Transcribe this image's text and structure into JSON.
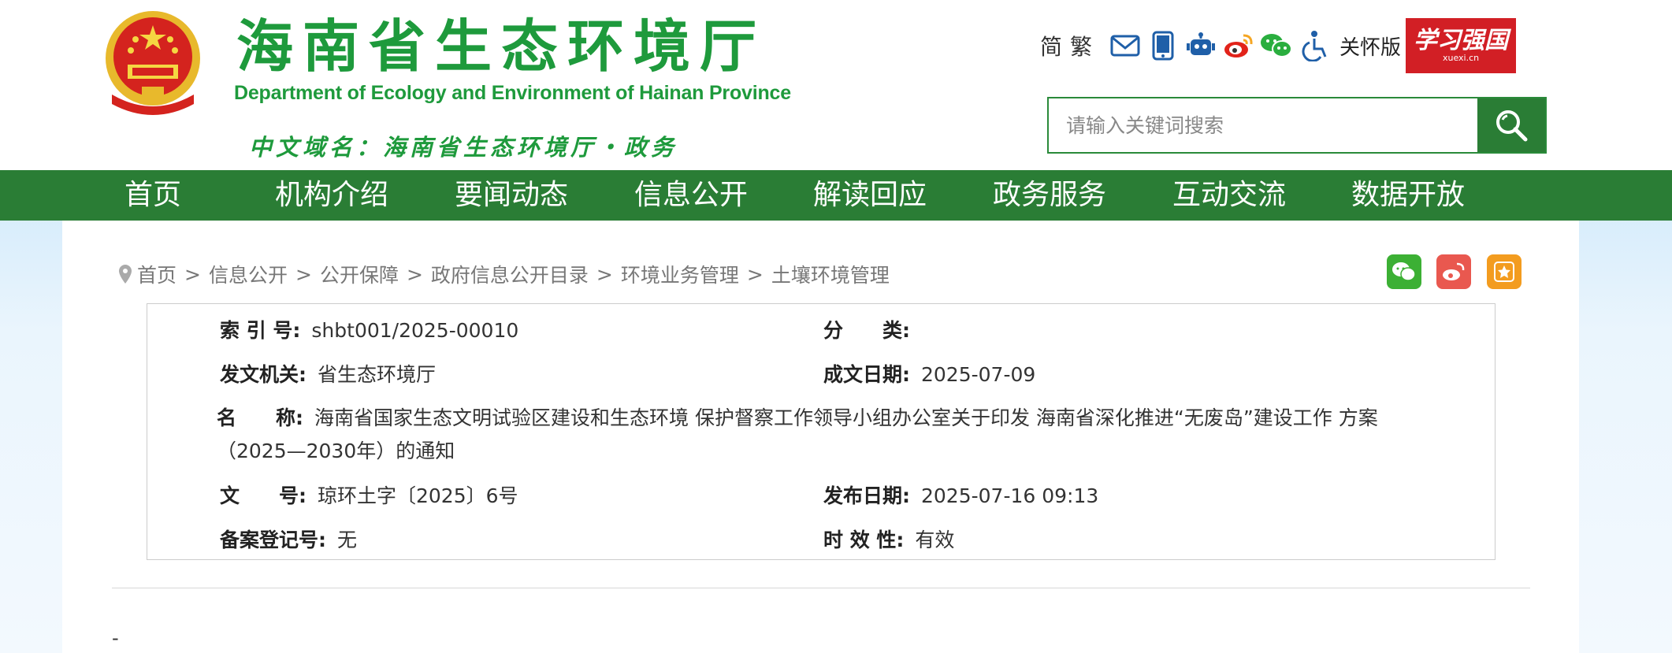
{
  "header": {
    "title": "海南省生态环境厅",
    "subtitle": "Department of Ecology and Environment of Hainan Province",
    "domain": "中文域名：海南省生态环境厅・政务"
  },
  "tools": {
    "lang_simplified": "简",
    "lang_traditional": "繁",
    "icons": [
      "mail-icon",
      "tablet-icon",
      "robot-icon",
      "weibo-icon",
      "wechat-icon",
      "accessibility-icon"
    ],
    "care_mode": "关怀版",
    "xuexi_main": "学习强国",
    "xuexi_sub": "xuexi.cn"
  },
  "search": {
    "placeholder": "请输入关键词搜索"
  },
  "nav": [
    "首页",
    "机构介绍",
    "要闻动态",
    "信息公开",
    "解读回应",
    "政务服务",
    "互动交流",
    "数据开放"
  ],
  "breadcrumb": [
    "首页",
    "信息公开",
    "公开保障",
    "政府信息公开目录",
    "环境业务管理",
    "土壤环境管理"
  ],
  "share": [
    "wechat-share-icon",
    "weibo-share-icon",
    "favorite-icon"
  ],
  "meta": {
    "index_label": "索 引 号:",
    "index_value": "shbt001/2025-00010",
    "category_label": "分　　类:",
    "category_value": "",
    "issuer_label": "发文机关:",
    "issuer_value": "省生态环境厅",
    "created_label": "成文日期:",
    "created_value": "2025-07-09",
    "name_label": "名　　称:",
    "name_value": "海南省国家生态文明试验区建设和生态环境 保护督察工作领导小组办公室关于印发 海南省深化推进“无废岛”建设工作 方案（2025—2030年）的通知",
    "docno_label": "文　　号:",
    "docno_value": "琼环土字〔2025〕6号",
    "published_label": "发布日期:",
    "published_value": "2025-07-16 09:13",
    "record_label": "备案登记号:",
    "record_value": "无",
    "validity_label": "时 效 性:",
    "validity_value": "有效"
  },
  "body": {
    "dash": "-"
  },
  "colors": {
    "brand_green": "#1e9a3c",
    "nav_green": "#2a7d35",
    "xuexi_red": "#d21f25"
  }
}
